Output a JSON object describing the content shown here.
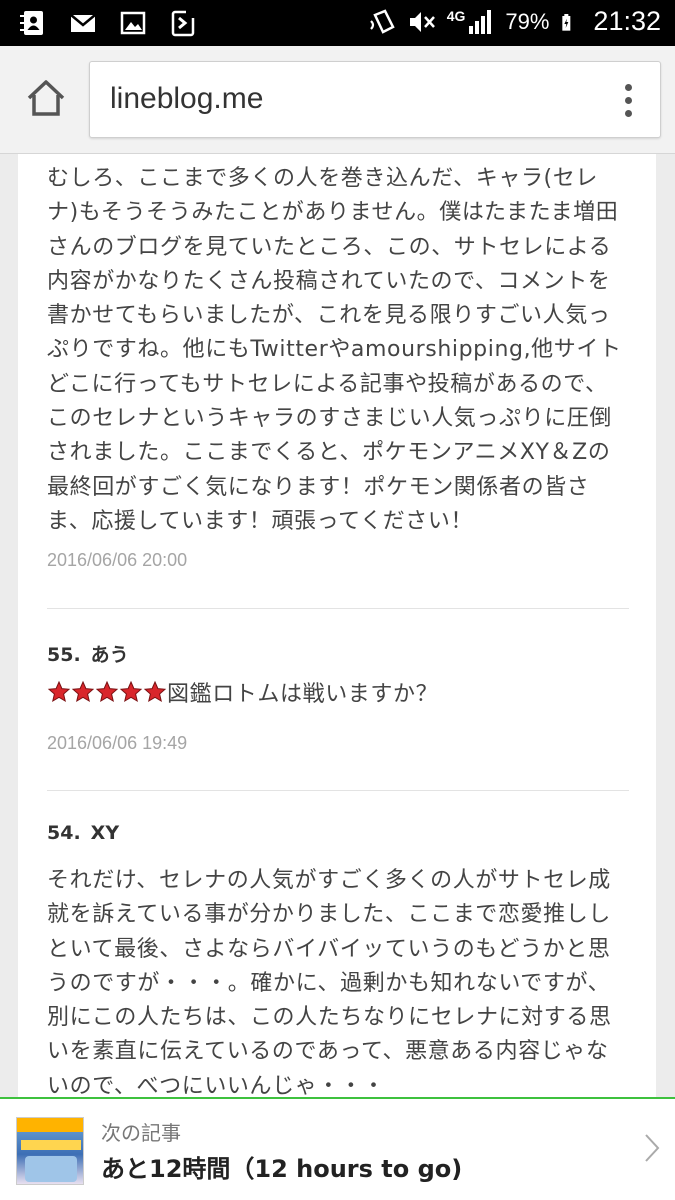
{
  "status_bar": {
    "network": "4G",
    "battery": "79%",
    "time": "21:32",
    "icons_left": [
      "contacts-icon",
      "mail-icon",
      "image-icon",
      "sync-icon"
    ],
    "icons_right": [
      "nfc-icon",
      "mute-icon",
      "signal-icon",
      "battery-icon"
    ]
  },
  "browser": {
    "url": "lineblog.me"
  },
  "comments": {
    "top": {
      "text": "むしろ、ここまで多くの人を巻き込んだ、キャラ(セレナ)もそうそうみたことがありません。僕はたまたま増田さんのブログを見ていたところ、この、サトセレによる内容がかなりたくさん投稿されていたので、コメントを書かせてもらいましたが、これを見る限りすごい人気っぷりですね。他にもTwitterやamourshipping,他サイトどこに行ってもサトセレによる記事や投稿があるので、このセレナというキャラのすさまじい人気っぷりに圧倒されました。ここまでくると、ポケモンアニメXY＆Zの最終回がすごく気になります！ポケモン関係者の皆さま、応援しています！頑張ってください！",
      "date": "2016/06/06 20:00"
    },
    "c55": {
      "number": "55.",
      "author": "あう",
      "star_count": 5,
      "text": "図鑑ロトムは戦いますか？",
      "date": "2016/06/06 19:49"
    },
    "c54": {
      "number": "54.",
      "author": "XY",
      "text": "それだけ、セレナの人気がすごく多くの人がサトセレ成就を訴えている事が分かりました、ここまで恋愛推ししといて最後、さよならバイバイッていうのもどうかと思うのですが・・・。確かに、過剰かも知れないですが、別にこの人たちは、この人たちなりにセレナに対する思いを素直に伝えているのであって、悪意ある内容じゃないので、べつにいいんじゃ・・・"
    }
  },
  "next_article": {
    "label": "次の記事",
    "title": "あと12時間（12 hours to go)"
  },
  "colors": {
    "accent_green": "#3ec13e",
    "star_red": "#d9262b"
  }
}
